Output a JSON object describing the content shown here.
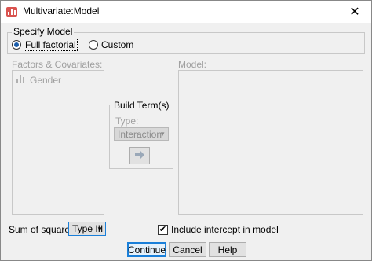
{
  "window": {
    "title": "Multivariate:Model"
  },
  "specify_model": {
    "legend": "Specify Model",
    "full_factorial": {
      "label": "Full factorial",
      "checked": true
    },
    "custom": {
      "label": "Custom",
      "checked": false
    }
  },
  "factors": {
    "label": "Factors & Covariates:",
    "items": [
      {
        "label": "Gender",
        "icon": "bar-chart-icon"
      }
    ]
  },
  "model": {
    "label": "Model:"
  },
  "build_terms": {
    "legend": "Build Term(s)",
    "type_label": "Type:",
    "type_value": "Interaction",
    "move_icon": "right-arrow-icon"
  },
  "sum_of_squares": {
    "label": "Sum of squares:",
    "value": "Type III"
  },
  "include_intercept": {
    "label": "Include intercept in model",
    "checked": true
  },
  "buttons": {
    "continue": "Continue",
    "cancel": "Cancel",
    "help": "Help"
  },
  "colors": {
    "accent": "#1a7fd9",
    "disabled_text": "#a0a0a0"
  }
}
